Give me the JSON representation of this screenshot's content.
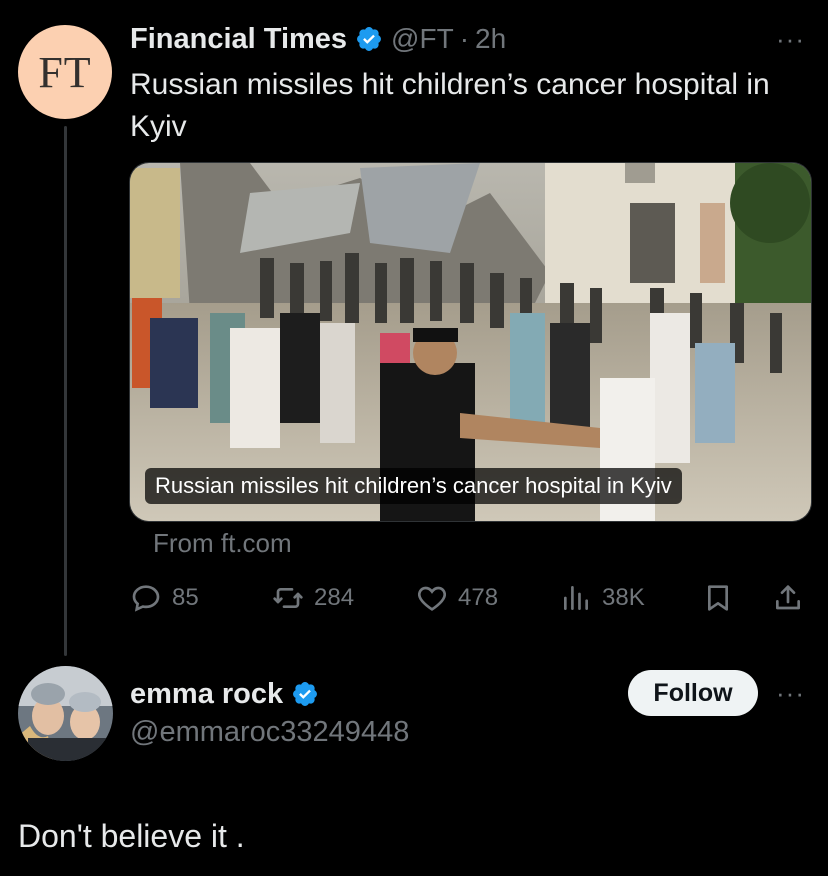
{
  "tweet": {
    "avatar_text": "FT",
    "display_name": "Financial Times",
    "handle": "@FT",
    "separator": "·",
    "time": "2h",
    "more": "···",
    "text": "Russian missiles hit children’s cancer hospital in Kyiv",
    "card": {
      "caption": "Russian missiles hit children’s cancer hospital in Kyiv",
      "source": "From ft.com"
    },
    "actions": {
      "replies": "85",
      "reposts": "284",
      "likes": "478",
      "views": "38K"
    }
  },
  "reply": {
    "display_name": "emma rock",
    "handle": "@emmaroc33249448",
    "follow_label": "Follow",
    "more": "···",
    "text": "Don't believe it ."
  },
  "colors": {
    "background": "#000000",
    "text": "#e7e9ea",
    "secondary": "#71767b",
    "verified": "#1d9bf0",
    "ft_pink": "#fcd0b1"
  },
  "icons": [
    "verified-badge-icon",
    "more-icon",
    "reply-icon",
    "repost-icon",
    "like-icon",
    "views-icon",
    "bookmark-icon",
    "share-icon"
  ]
}
